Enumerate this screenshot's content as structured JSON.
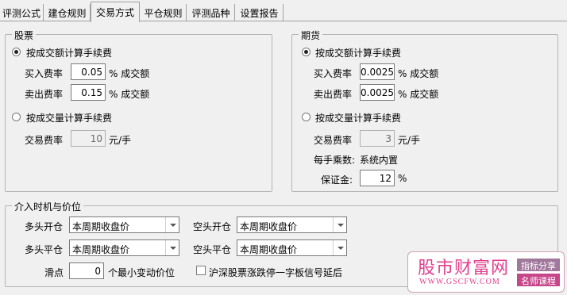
{
  "tabs": [
    "评测公式",
    "建仓规则",
    "交易方式",
    "平仓规则",
    "评测品种",
    "设置报告"
  ],
  "stock": {
    "title": "股票",
    "radio_amount": "按成交额计算手续费",
    "buy_label": "买入费率",
    "buy_value": "0.05",
    "buy_unit": "% 成交额",
    "sell_label": "卖出费率",
    "sell_value": "0.15",
    "sell_unit": "% 成交额",
    "radio_volume": "按成交量计算手续费",
    "fee_label": "交易费率",
    "fee_value": "10",
    "fee_unit": "元/手"
  },
  "futures": {
    "title": "期货",
    "radio_amount": "按成交额计算手续费",
    "buy_label": "买入费率",
    "buy_value": "0.0025",
    "buy_unit": "% 成交额",
    "sell_label": "卖出费率",
    "sell_value": "0.0025",
    "sell_unit": "% 成交额",
    "radio_volume": "按成交量计算手续费",
    "fee_label": "交易费率",
    "fee_value": "3",
    "fee_unit": "元/手",
    "multiplier_label": "每手乘数:",
    "multiplier_value": "系统内置",
    "margin_label": "保证金:",
    "margin_value": "12",
    "margin_unit": "%"
  },
  "timing": {
    "title": "介入时机与价位",
    "long_open_label": "多头开仓",
    "long_open_value": "本周期收盘价",
    "long_close_label": "多头平仓",
    "long_close_value": "本周期收盘价",
    "short_open_label": "空头开仓",
    "short_open_value": "本周期收盘价",
    "short_close_label": "空头平仓",
    "short_close_value": "本周期收盘价",
    "slippage_label": "滑点",
    "slippage_value": "0",
    "slippage_unit": "个最小变动价位",
    "limit_delay_label": "沪深股票涨跌停一字板信号延后"
  },
  "watermark": {
    "brand": "股市财富网",
    "url": "WWW.GSCFW.COM",
    "tag1": "指标分享",
    "tag2": "名师课程",
    "colors": {
      "pink": "#e2408e",
      "tag1": "#a0789c",
      "tag2": "#c7468a"
    }
  }
}
